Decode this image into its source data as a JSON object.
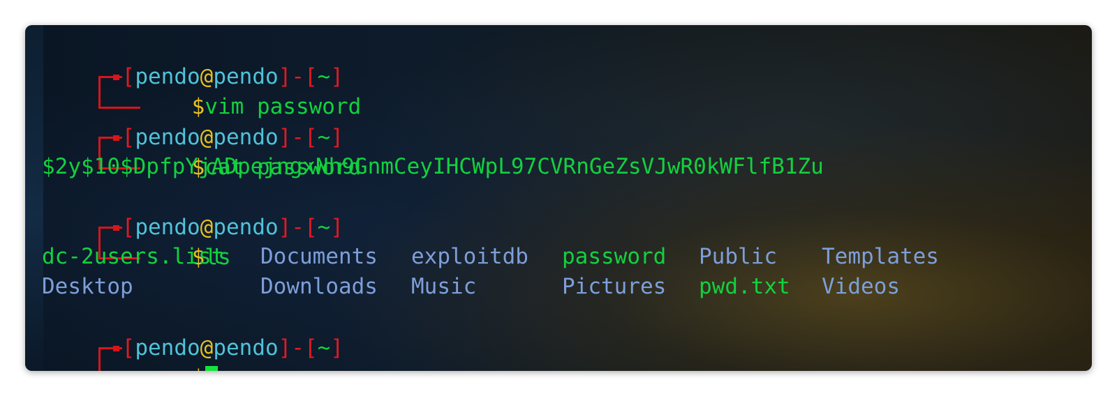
{
  "prompt": {
    "user": "pendo",
    "at": "@",
    "host": "pendo",
    "open_bracket": "[",
    "close_bracket": "]",
    "dash": "-",
    "path": "~",
    "dollar": "$"
  },
  "commands": [
    {
      "text": "vim password"
    },
    {
      "text": "cat password"
    },
    {
      "text": "ls"
    }
  ],
  "output": {
    "hash": "$2y$10$DpfpYjADpejngxNh9GnmCeyIHCWpL97CVRnGeZsVJwR0kWFlfB1Zu"
  },
  "ls_listing": {
    "row1": [
      "dc-2users.list",
      "Documents",
      "exploitdb",
      "password",
      "Public",
      "Templates"
    ],
    "row2": [
      "Desktop",
      "Downloads",
      "Music",
      "Pictures",
      "pwd.txt",
      "Videos"
    ]
  },
  "colors": {
    "bracket_red": "#e21a22",
    "user_cyan": "#4fc3d9",
    "at_yellow": "#e7c021",
    "text_green": "#13d13f",
    "dir_blue": "#7d9fd9",
    "cursor_green": "#13e43b"
  }
}
